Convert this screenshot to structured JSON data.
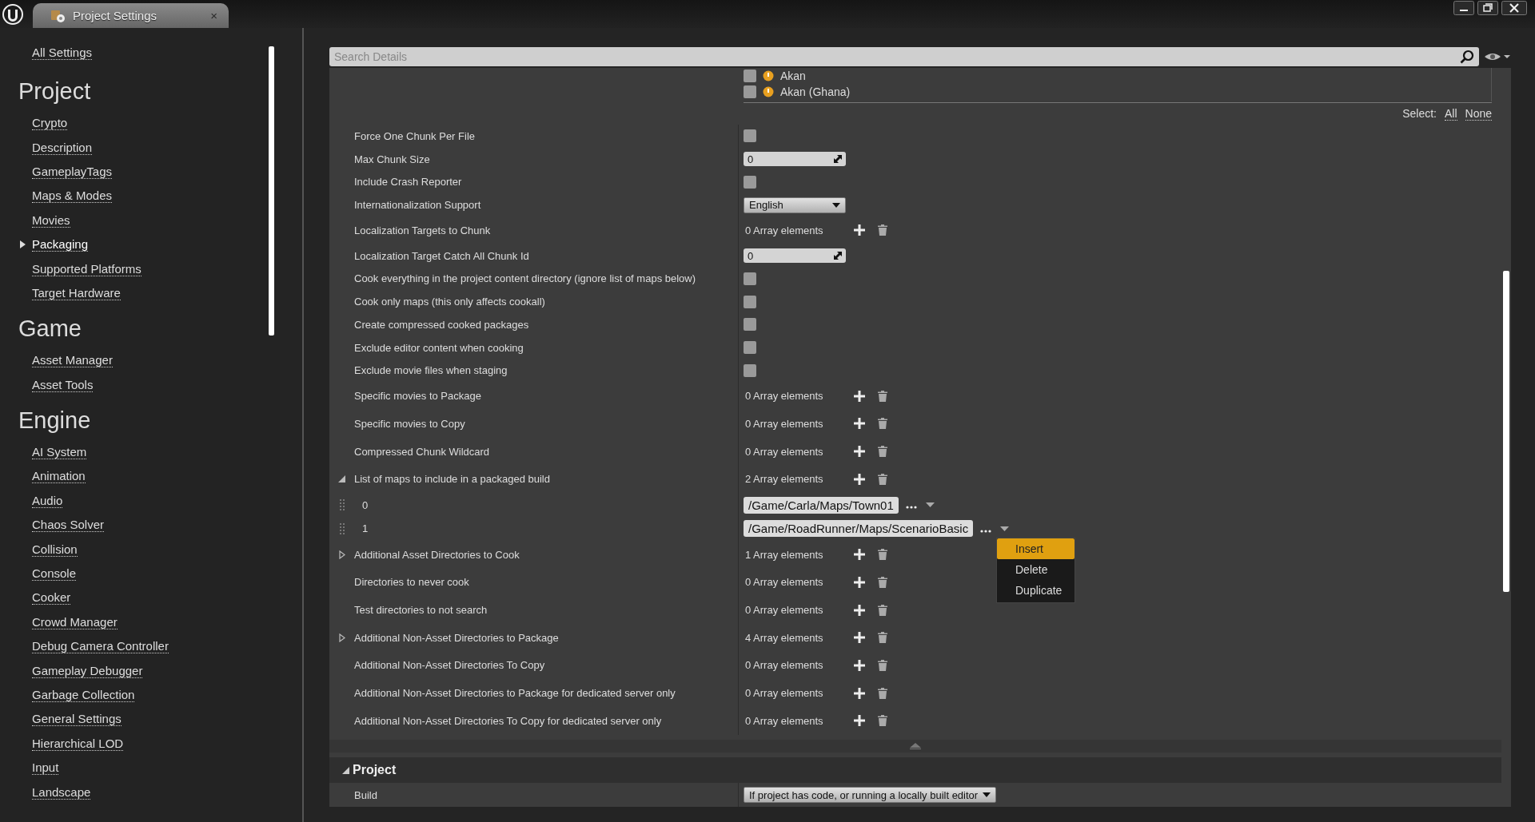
{
  "title_bar": {
    "tab": {
      "title": "Project Settings",
      "close": "×"
    }
  },
  "sidebar": {
    "top_link": "All Settings",
    "sections": [
      {
        "heading": "Project",
        "items": [
          {
            "label": "Crypto",
            "selected": false
          },
          {
            "label": "Description",
            "selected": false
          },
          {
            "label": "GameplayTags",
            "selected": false
          },
          {
            "label": "Maps & Modes",
            "selected": false
          },
          {
            "label": "Movies",
            "selected": false
          },
          {
            "label": "Packaging",
            "selected": true
          },
          {
            "label": "Supported Platforms",
            "selected": false
          },
          {
            "label": "Target Hardware",
            "selected": false
          }
        ]
      },
      {
        "heading": "Game",
        "items": [
          {
            "label": "Asset Manager",
            "selected": false
          },
          {
            "label": "Asset Tools",
            "selected": false
          }
        ]
      },
      {
        "heading": "Engine",
        "items": [
          {
            "label": "AI System",
            "selected": false
          },
          {
            "label": "Animation",
            "selected": false
          },
          {
            "label": "Audio",
            "selected": false
          },
          {
            "label": "Chaos Solver",
            "selected": false
          },
          {
            "label": "Collision",
            "selected": false
          },
          {
            "label": "Console",
            "selected": false
          },
          {
            "label": "Cooker",
            "selected": false
          },
          {
            "label": "Crowd Manager",
            "selected": false
          },
          {
            "label": "Debug Camera Controller",
            "selected": false
          },
          {
            "label": "Gameplay Debugger",
            "selected": false
          },
          {
            "label": "Garbage Collection",
            "selected": false
          },
          {
            "label": "General Settings",
            "selected": false
          },
          {
            "label": "Hierarchical LOD",
            "selected": false
          },
          {
            "label": "Input",
            "selected": false
          },
          {
            "label": "Landscape",
            "selected": false
          }
        ]
      }
    ]
  },
  "search": {
    "placeholder": "Search Details"
  },
  "culture_list": {
    "items": [
      {
        "label": "Akan",
        "checked": false
      },
      {
        "label": "Akan (Ghana)",
        "checked": false
      }
    ],
    "select_label": "Select:",
    "select_links": [
      "All",
      "None"
    ]
  },
  "settings": [
    {
      "label": "Force One Chunk Per File",
      "kind": "checkbox",
      "checked": false
    },
    {
      "label": "Max Chunk Size",
      "kind": "number",
      "value": "0"
    },
    {
      "label": "Include Crash Reporter",
      "kind": "checkbox",
      "checked": false
    },
    {
      "label": "Internationalization Support",
      "kind": "dropdown",
      "value": "English"
    },
    {
      "label": "Localization Targets to Chunk",
      "kind": "array",
      "value": "0 Array elements"
    },
    {
      "label": "Localization Target Catch All Chunk Id",
      "kind": "number",
      "value": "0"
    },
    {
      "label": "Cook everything in the project content directory (ignore list of maps below)",
      "kind": "checkbox",
      "checked": false
    },
    {
      "label": "Cook only maps (this only affects cookall)",
      "kind": "checkbox",
      "checked": false
    },
    {
      "label": "Create compressed cooked packages",
      "kind": "checkbox",
      "checked": false
    },
    {
      "label": "Exclude editor content when cooking",
      "kind": "checkbox",
      "checked": false
    },
    {
      "label": "Exclude movie files when staging",
      "kind": "checkbox",
      "checked": false
    },
    {
      "label": "Specific movies to Package",
      "kind": "array",
      "value": "0 Array elements"
    },
    {
      "label": "Specific movies to Copy",
      "kind": "array",
      "value": "0 Array elements"
    },
    {
      "label": "Compressed Chunk Wildcard",
      "kind": "array",
      "value": "0 Array elements"
    },
    {
      "label": "List of maps to include in a packaged build",
      "kind": "array",
      "value": "2 Array elements",
      "expanded": true
    },
    {
      "label": "0",
      "kind": "element",
      "value": "/Game/Carla/Maps/Town01"
    },
    {
      "label": "1",
      "kind": "element",
      "value": "/Game/RoadRunner/Maps/ScenarioBasic",
      "context_menu": {
        "items": [
          {
            "label": "Insert",
            "selected": true
          },
          {
            "label": "Delete",
            "selected": false
          },
          {
            "label": "Duplicate",
            "selected": false
          }
        ]
      }
    },
    {
      "label": "Additional Asset Directories to Cook",
      "kind": "array",
      "value": "1 Array elements",
      "expanded": false
    },
    {
      "label": "Directories to never cook",
      "kind": "array",
      "value": "0 Array elements"
    },
    {
      "label": "Test directories to not search",
      "kind": "array",
      "value": "0 Array elements"
    },
    {
      "label": "Additional Non-Asset Directories to Package",
      "kind": "array",
      "value": "4 Array elements",
      "expanded": false
    },
    {
      "label": "Additional Non-Asset Directories To Copy",
      "kind": "array",
      "value": "0 Array elements"
    },
    {
      "label": "Additional Non-Asset Directories to Package for dedicated server only",
      "kind": "array",
      "value": "0 Array elements"
    },
    {
      "label": "Additional Non-Asset Directories To Copy for dedicated server only",
      "kind": "array",
      "value": "0 Array elements"
    }
  ],
  "category": {
    "title": "Project",
    "expanded": true,
    "rows": [
      {
        "label": "Build",
        "kind": "dropdown",
        "value": "If project has code, or running a locally built editor"
      }
    ]
  }
}
